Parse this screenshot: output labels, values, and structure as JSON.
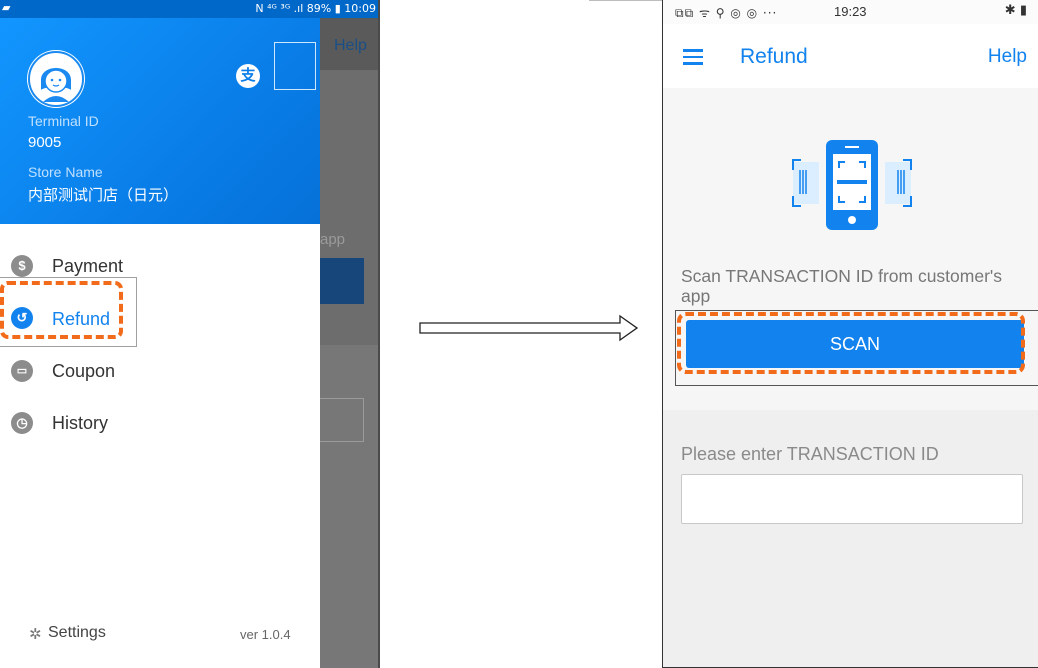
{
  "left_screen": {
    "status_bar": {
      "indicators": "N  ⁴ᴳ  ³ᴳ .ıl 89%",
      "time": "10:09"
    },
    "background": {
      "help": "Help",
      "app_text": "app"
    },
    "drawer": {
      "terminal_id_label": "Terminal ID",
      "terminal_id": "9005",
      "store_name_label": "Store Name",
      "store_name": "内部测试门店（日元）",
      "menu": [
        {
          "label": "Payment",
          "icon": "dollar-icon"
        },
        {
          "label": "Refund",
          "icon": "refund-icon"
        },
        {
          "label": "Coupon",
          "icon": "coupon-icon"
        },
        {
          "label": "History",
          "icon": "history-icon"
        }
      ],
      "settings_label": "Settings",
      "version": "ver 1.0.4"
    }
  },
  "right_screen": {
    "status_bar": {
      "time": "19:23",
      "icons": "⧉⧉ ᯤ ⚲ ◎ ◎ ···"
    },
    "toolbar": {
      "title": "Refund",
      "help": "Help"
    },
    "scan_instruction": "Scan TRANSACTION ID from customer's app",
    "scan_button": "SCAN",
    "entry_label": "Please enter TRANSACTION ID",
    "entry_value": ""
  },
  "colors": {
    "brand_blue": "#1283ee",
    "highlight_orange": "#f26b1b"
  }
}
